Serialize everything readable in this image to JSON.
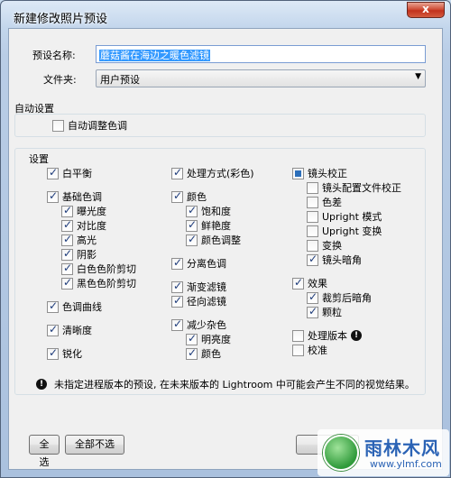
{
  "window": {
    "title": "新建修改照片预设",
    "close_glyph": "x"
  },
  "form": {
    "preset_name_label": "预设名称:",
    "preset_name_value": "蘑菇酱在海边之暖色滤镜",
    "folder_label": "文件夹:",
    "folder_value": "用户预设"
  },
  "auto_settings": {
    "group_label": "自动设置",
    "auto_tone_label": "自动调整色调",
    "auto_tone_checked": false
  },
  "settings": {
    "group_label": "设置",
    "col1": {
      "white_balance": "白平衡",
      "basic_tone": "基础色调",
      "exposure": "曝光度",
      "contrast": "对比度",
      "highlights": "高光",
      "shadows": "阴影",
      "white_clipping": "白色色阶剪切",
      "black_clipping": "黑色色阶剪切",
      "tone_curve": "色调曲线",
      "clarity": "清晰度",
      "sharpening": "锐化"
    },
    "col2": {
      "treatment": "处理方式(彩色)",
      "color": "颜色",
      "saturation": "饱和度",
      "vibrance": "鲜艳度",
      "color_adjust": "颜色调整",
      "split_toning": "分离色调",
      "graduated_filters": "渐变滤镜",
      "radial_filters": "径向滤镜",
      "noise_reduction": "减少杂色",
      "luminance": "明亮度",
      "nr_color": "颜色"
    },
    "col3": {
      "lens_corrections": "镜头校正",
      "lens_profile": "镜头配置文件校正",
      "chromatic_aberration": "色差",
      "upright_mode": "Upright 模式",
      "upright_transforms": "Upright 变换",
      "transform": "变换",
      "lens_vignetting": "镜头暗角",
      "effects": "效果",
      "post_crop_vignetting": "裁剪后暗角",
      "grain": "颗粒",
      "process_version": "处理版本",
      "calibration": "校准"
    }
  },
  "note": {
    "icon": "info-icon",
    "text": "未指定进程版本的预设, 在未来版本的 Lightroom 中可能会产生不同的视觉结果。"
  },
  "buttons": {
    "select_all": "全选",
    "select_none": "全部不选"
  },
  "watermark": {
    "brand": "雨林木风",
    "url": "www.ylmf.com"
  }
}
